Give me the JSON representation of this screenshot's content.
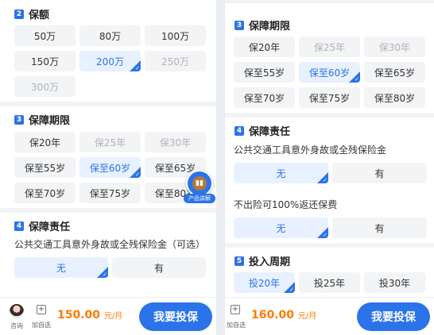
{
  "left": {
    "coverage": {
      "num": "2",
      "title": "保额",
      "options": [
        "50万",
        "80万",
        "100万",
        "150万",
        "200万",
        "250万",
        "300万"
      ]
    },
    "term": {
      "num": "3",
      "title": "保障期限",
      "options": [
        "保20年",
        "保25年",
        "保30年",
        "保至55岁",
        "保至60岁",
        "保至65岁",
        "保至70岁",
        "保至75岁",
        "保至80岁"
      ]
    },
    "responsibility": {
      "num": "4",
      "title": "保障责任",
      "desc": "公共交通工具意外身故或全残保险金（可选）",
      "options": [
        "无",
        "有"
      ]
    },
    "floating": {
      "icon": "chart-icon",
      "label": "产品讲解"
    },
    "bottom": {
      "consult_label": "咨询",
      "add_label": "加自选",
      "price": "150.00",
      "unit": "元/月",
      "buy": "我要投保"
    }
  },
  "right": {
    "term": {
      "num": "3",
      "title": "保障期限",
      "options": [
        "保20年",
        "保25年",
        "保30年",
        "保至55岁",
        "保至60岁",
        "保至65岁",
        "保至70岁",
        "保至75岁",
        "保至80岁"
      ]
    },
    "responsibility": {
      "num": "4",
      "title": "保障责任",
      "desc1": "公共交通工具意外身故或全残保险金",
      "options1": [
        "无",
        "有"
      ],
      "desc2": "不出险可100%返还保费",
      "options2": [
        "无",
        "有"
      ]
    },
    "period": {
      "num": "5",
      "title": "投入周期",
      "options": [
        "投20年",
        "投25年",
        "投30年"
      ]
    },
    "bottom": {
      "add_label": "加自选",
      "price": "160.00",
      "unit": "元/月",
      "buy": "我要投保"
    }
  },
  "colors": {
    "accent": "#2b73e8",
    "price": "#ff7a00",
    "selected_bg": "#e8f1ff"
  }
}
